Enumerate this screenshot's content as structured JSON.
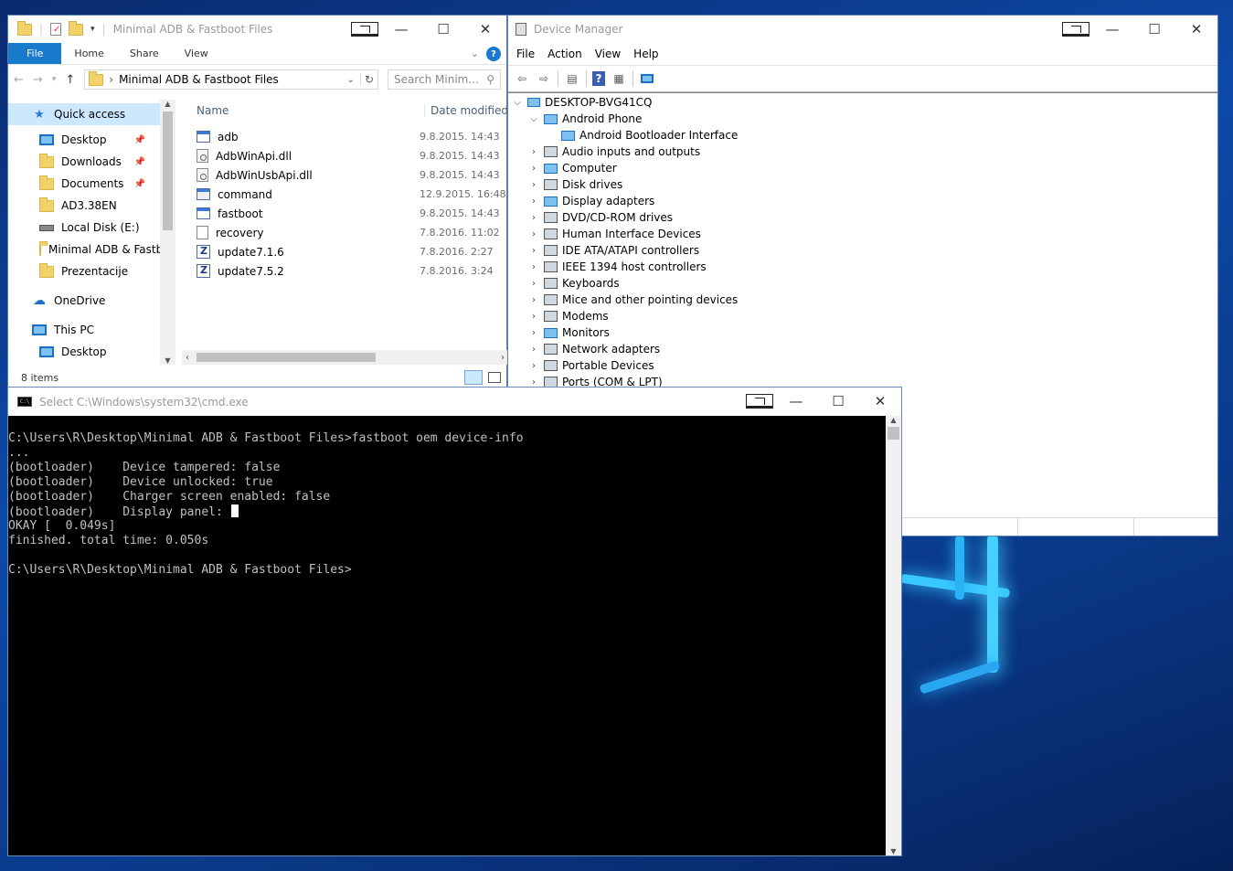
{
  "explorer": {
    "title": "Minimal ADB & Fastboot Files",
    "tabs": [
      "File",
      "Home",
      "Share",
      "View"
    ],
    "address": "Minimal ADB & Fastboot Files",
    "search_placeholder": "Search Minim...",
    "nav": [
      {
        "label": "Quick access",
        "icon": "star-icon",
        "selected": true
      },
      {
        "label": "Desktop",
        "icon": "desktop-icon",
        "pinned": true
      },
      {
        "label": "Downloads",
        "icon": "folder-icon",
        "pinned": true
      },
      {
        "label": "Documents",
        "icon": "folder-icon",
        "pinned": true
      },
      {
        "label": "AD3.38EN",
        "icon": "folder-icon"
      },
      {
        "label": "Local Disk (E:)",
        "icon": "drive-icon"
      },
      {
        "label": "Minimal ADB & Fastb",
        "icon": "folder-icon"
      },
      {
        "label": "Prezentacije",
        "icon": "folder-icon"
      },
      {
        "label": "OneDrive",
        "icon": "cloud-icon"
      },
      {
        "label": "This PC",
        "icon": "computer-icon"
      },
      {
        "label": "Desktop",
        "icon": "desktop-icon"
      }
    ],
    "columns": {
      "name": "Name",
      "date": "Date modified"
    },
    "files": [
      {
        "name": "adb",
        "date": "9.8.2015. 14:43",
        "icon": "app-icon"
      },
      {
        "name": "AdbWinApi.dll",
        "date": "9.8.2015. 14:43",
        "icon": "dll-icon"
      },
      {
        "name": "AdbWinUsbApi.dll",
        "date": "9.8.2015. 14:43",
        "icon": "dll-icon"
      },
      {
        "name": "command",
        "date": "12.9.2015. 16:48",
        "icon": "cmd-icon"
      },
      {
        "name": "fastboot",
        "date": "9.8.2015. 14:43",
        "icon": "app-icon"
      },
      {
        "name": "recovery",
        "date": "7.8.2016. 11:02",
        "icon": "file-icon"
      },
      {
        "name": "update7.1.6",
        "date": "7.8.2016. 2:27",
        "icon": "zip-icon"
      },
      {
        "name": "update7.5.2",
        "date": "7.8.2016. 3:24",
        "icon": "zip-icon"
      }
    ],
    "status": "8 items"
  },
  "devmgr": {
    "title": "Device Manager",
    "menu": [
      "File",
      "Action",
      "View",
      "Help"
    ],
    "root": "DESKTOP-BVG41CQ",
    "nodes": [
      {
        "label": "Android Phone",
        "expanded": true,
        "level": 1
      },
      {
        "label": "Android Bootloader Interface",
        "level": 2
      },
      {
        "label": "Audio inputs and outputs",
        "level": 1
      },
      {
        "label": "Computer",
        "level": 1
      },
      {
        "label": "Disk drives",
        "level": 1
      },
      {
        "label": "Display adapters",
        "level": 1
      },
      {
        "label": "DVD/CD-ROM drives",
        "level": 1
      },
      {
        "label": "Human Interface Devices",
        "level": 1
      },
      {
        "label": "IDE ATA/ATAPI controllers",
        "level": 1
      },
      {
        "label": "IEEE 1394 host controllers",
        "level": 1
      },
      {
        "label": "Keyboards",
        "level": 1
      },
      {
        "label": "Mice and other pointing devices",
        "level": 1
      },
      {
        "label": "Modems",
        "level": 1
      },
      {
        "label": "Monitors",
        "level": 1
      },
      {
        "label": "Network adapters",
        "level": 1
      },
      {
        "label": "Portable Devices",
        "level": 1
      },
      {
        "label": "Ports (COM & LPT)",
        "level": 1
      }
    ]
  },
  "cmd": {
    "title": "Select C:\\Windows\\system32\\cmd.exe",
    "lines": [
      "C:\\Users\\R\\Desktop\\Minimal ADB & Fastboot Files>fastboot oem device-info",
      "...",
      "(bootloader)    Device tampered: false",
      "(bootloader)    Device unlocked: true",
      "(bootloader)    Charger screen enabled: false",
      "(bootloader)    Display panel:",
      "OKAY [  0.049s]",
      "finished. total time: 0.050s",
      "",
      "C:\\Users\\R\\Desktop\\Minimal ADB & Fastboot Files>"
    ]
  },
  "colors": {
    "accent": "#1979ca",
    "console_bg": "#000000",
    "console_fg": "#c0c0c0",
    "desktop": "#0d4aa8"
  }
}
